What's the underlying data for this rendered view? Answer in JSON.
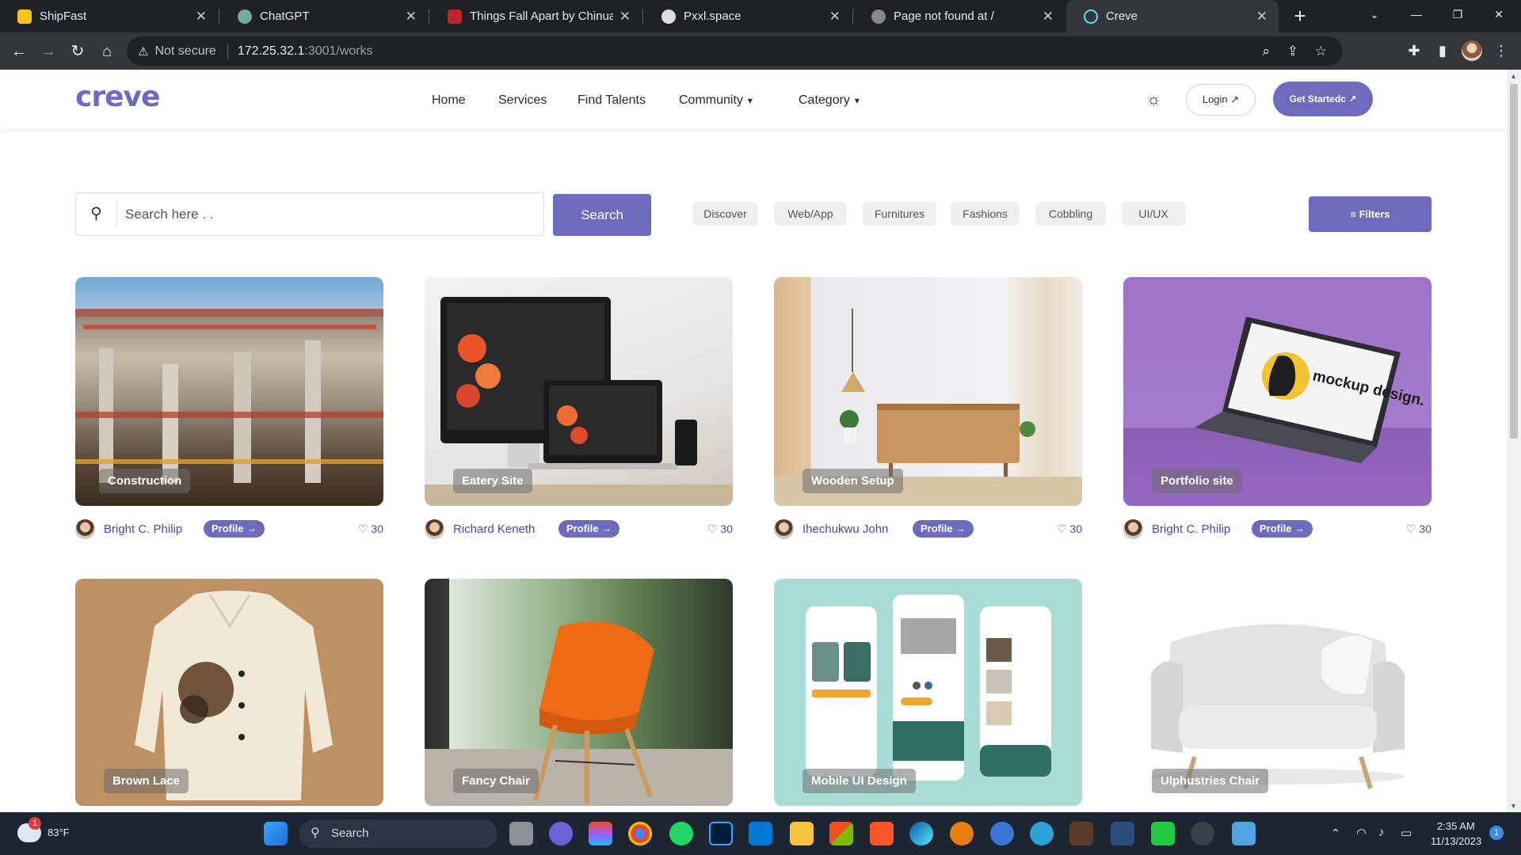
{
  "browser": {
    "tabs": [
      {
        "title": "ShipFast",
        "favicon_color": "#f5c518"
      },
      {
        "title": "ChatGPT",
        "favicon_color": "#74aa9c"
      },
      {
        "title": "Things Fall Apart by Chinua Achebe",
        "favicon_color": "#c0262d"
      },
      {
        "title": "Pxxl.space",
        "favicon_color": "#dddddd"
      },
      {
        "title": "Page not found at /",
        "favicon_color": "#888888"
      },
      {
        "title": "Creve",
        "favicon_color": "#61dafb"
      }
    ],
    "active_tab": 5,
    "security_label": "Not secure",
    "url_host": "172.25.32.1",
    "url_path": ":3001/works"
  },
  "site": {
    "logo": "creve",
    "nav": [
      {
        "label": "Home",
        "dropdown": false
      },
      {
        "label": "Services",
        "dropdown": false
      },
      {
        "label": "Find Talents",
        "dropdown": false
      },
      {
        "label": "Community",
        "dropdown": true
      },
      {
        "label": "Category",
        "dropdown": true
      }
    ],
    "login_label": "Login ↗",
    "start_label": "Get Startedc ↗",
    "accent_color": "#6e6bbf"
  },
  "search": {
    "placeholder": "Search here . .",
    "button_label": "Search"
  },
  "categories": [
    "Discover",
    "Web/App",
    "Furnitures",
    "Fashions",
    "Cobbling",
    "UI/UX"
  ],
  "filters_label": "Filters",
  "works": [
    {
      "title": "Construction",
      "author": "Bright C. Philip",
      "profile_label": "Profile →",
      "likes": "30"
    },
    {
      "title": "Eatery Site",
      "author": "Richard Keneth",
      "profile_label": "Profile →",
      "likes": "30"
    },
    {
      "title": "Wooden Setup",
      "author": "Ihechukwu John",
      "profile_label": "Profile →",
      "likes": "30"
    },
    {
      "title": "Portfolio site",
      "author": "Bright C. Philip",
      "profile_label": "Profile →",
      "likes": "30"
    },
    {
      "title": "Brown Lace"
    },
    {
      "title": "Fancy Chair"
    },
    {
      "title": "Mobile UI Design"
    },
    {
      "title": "Ulphustries Chair"
    }
  ],
  "mockup_text": "mockup design.",
  "taskbar": {
    "weather_temp": "83°F",
    "weather_badge": "1",
    "search_label": "Search",
    "time": "2:35 AM",
    "date": "11/13/2023",
    "notification_count": "1"
  }
}
